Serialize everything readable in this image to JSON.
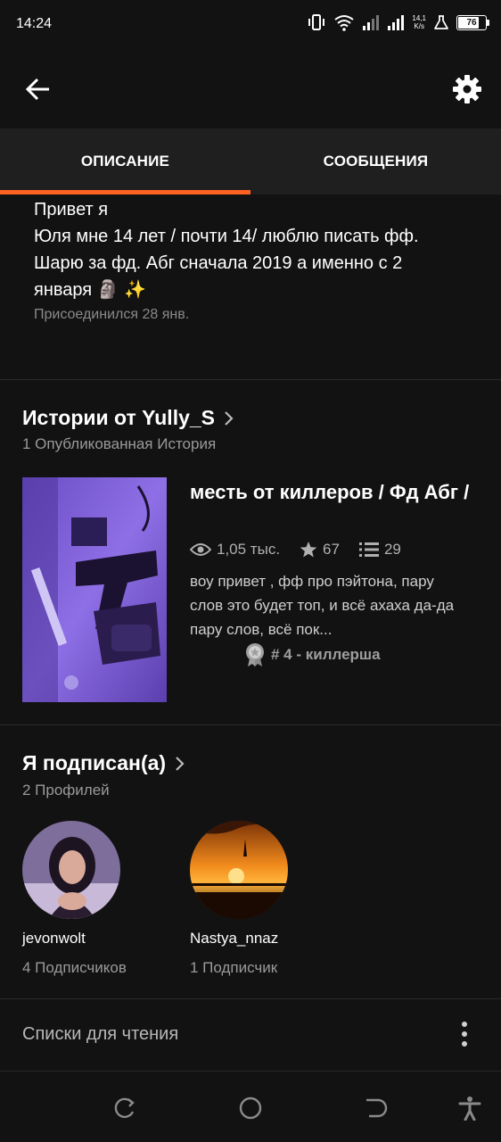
{
  "status_bar": {
    "time": "14:24",
    "speed_value": "14,1",
    "speed_unit": "K/s",
    "battery": "76",
    "battery_level": 0.76
  },
  "app_bar": {
    "back_icon": "arrow-left-icon",
    "settings_icon": "gear-icon"
  },
  "tabs": [
    {
      "label": "ОПИСАНИЕ",
      "active": true
    },
    {
      "label": "СООБЩЕНИЯ",
      "active": false
    }
  ],
  "description": {
    "lines": [
      "Привет я",
      "Юля мне 14 лет / почти 14/ люблю писать фф.",
      "Шарю за фд. Абг сначала 2019 а именно с 2",
      "января 🗿 ✨"
    ],
    "joined": "Присоединился 28 янв."
  },
  "stories_section": {
    "title": "Истории от Yully_S",
    "subtitle": "1 Опубликованная История",
    "story": {
      "title": "месть от киллеров / Фд Абг /",
      "views": "1,05 тыс.",
      "votes": "67",
      "parts": "29",
      "description": "воу привет , фф про пэйтона, пару слов это будет топ, и всё ахаха да-да пару слов, всё пок...",
      "rank": "# 4 - киллерша"
    }
  },
  "following_section": {
    "title": "Я подписан(а)",
    "subtitle": "2 Профилей",
    "profiles": [
      {
        "name": "jevonwolt",
        "followers": "4 Подписчиков"
      },
      {
        "name": "Nastya_nnaz",
        "followers": "1 Подписчик"
      }
    ]
  },
  "reading_lists": {
    "label": "Списки для чтения"
  },
  "colors": {
    "accent": "#ff6122",
    "background": "#121212",
    "tab_bar": "#1f1f1f"
  }
}
